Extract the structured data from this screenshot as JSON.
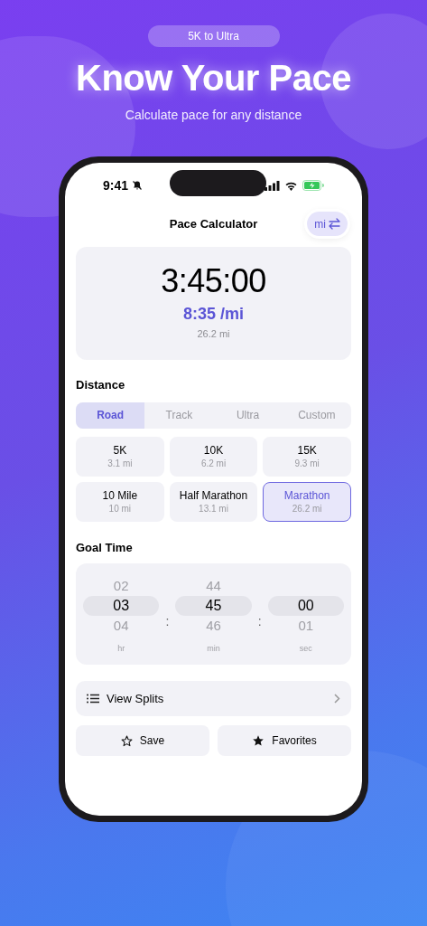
{
  "promo": {
    "badge": "5K to Ultra",
    "headline": "Know Your Pace",
    "subtitle": "Calculate pace for any distance"
  },
  "status_bar": {
    "time": "9:41"
  },
  "nav": {
    "title": "Pace Calculator",
    "unit_toggle": "mi"
  },
  "result": {
    "time": "3:45:00",
    "pace": "8:35 /mi",
    "distance": "26.2 mi"
  },
  "distance": {
    "heading": "Distance",
    "tabs": [
      {
        "label": "Road",
        "selected": true
      },
      {
        "label": "Track",
        "selected": false
      },
      {
        "label": "Ultra",
        "selected": false
      },
      {
        "label": "Custom",
        "selected": false
      }
    ],
    "options": [
      {
        "name": "5K",
        "detail": "3.1 mi",
        "selected": false
      },
      {
        "name": "10K",
        "detail": "6.2 mi",
        "selected": false
      },
      {
        "name": "15K",
        "detail": "9.3 mi",
        "selected": false
      },
      {
        "name": "10 Mile",
        "detail": "10 mi",
        "selected": false
      },
      {
        "name": "Half Marathon",
        "detail": "13.1 mi",
        "selected": false
      },
      {
        "name": "Marathon",
        "detail": "26.2 mi",
        "selected": true
      }
    ]
  },
  "goal_time": {
    "heading": "Goal Time",
    "separator": ":",
    "columns": [
      {
        "label": "hr",
        "items": [
          {
            "value": "02",
            "selected": false
          },
          {
            "value": "03",
            "selected": true
          },
          {
            "value": "04",
            "selected": false
          }
        ]
      },
      {
        "label": "min",
        "items": [
          {
            "value": "44",
            "selected": false
          },
          {
            "value": "45",
            "selected": true
          },
          {
            "value": "46",
            "selected": false
          }
        ]
      },
      {
        "label": "sec",
        "items": [
          {
            "value": "00",
            "selected": true
          },
          {
            "value": "01",
            "selected": false
          }
        ]
      }
    ]
  },
  "splits": {
    "label": "View Splits"
  },
  "buttons": [
    {
      "kind": "outline-star",
      "label": "Save"
    },
    {
      "kind": "filled-star",
      "label": "Favorites"
    }
  ]
}
